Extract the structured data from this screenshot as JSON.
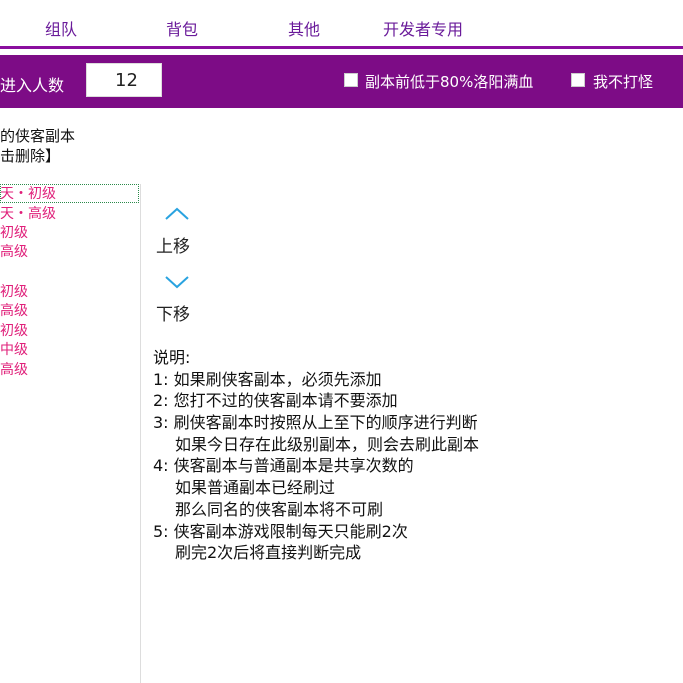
{
  "tabs": [
    "组队",
    "背包",
    "其他",
    "开发者专用"
  ],
  "toolbar": {
    "count_label": "进入人数",
    "count_value": "12",
    "option1_label": "副本前低于80%洛阳满血",
    "option2_label": "我不打怪"
  },
  "list": {
    "title_line1": "的侠客副本",
    "title_line2": "击删除】",
    "items": [
      "天・初级",
      "天・高级",
      "初级",
      "高级",
      "",
      "初级",
      "高级",
      "初级",
      "中级",
      "高级"
    ]
  },
  "move": {
    "up_label": "上移",
    "down_label": "下移"
  },
  "description": {
    "heading": "说明:",
    "lines": [
      "1: 如果刷侠客副本，必须先添加",
      "2: 您打不过的侠客副本请不要添加",
      "3: 刷侠客副本时按照从上至下的顺序进行判断",
      "   如果今日存在此级别副本，则会去刷此副本",
      "4: 侠客副本与普通副本是共享次数的",
      "   如果普通副本已经刷过",
      "   那么同名的侠客副本将不可刷",
      "5: 侠客副本游戏限制每天只能刷2次",
      "   刷完2次后将直接判断完成"
    ]
  },
  "colors": {
    "accent": "#7d0c86",
    "list_text": "#e0207a",
    "arrow": "#29a3e0"
  }
}
